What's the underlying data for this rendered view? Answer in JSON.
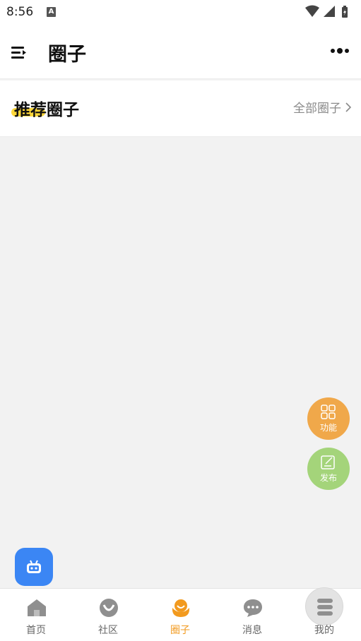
{
  "status_bar": {
    "time": "8:56",
    "notification_glyph": "A",
    "icons": [
      "wifi-icon",
      "signal-icon",
      "battery-icon"
    ]
  },
  "header": {
    "title": "圈子",
    "menu_icon": "menu-icon",
    "more_icon": "more-dots-icon"
  },
  "section": {
    "title": "推荐圈子",
    "all_link": "全部圈子",
    "highlight_color": "#ffd83a"
  },
  "floating": {
    "function_label": "功能",
    "post_label": "发布",
    "function_color": "#f0a84a",
    "post_color": "#a4d47a",
    "bot_color": "#3b86f4"
  },
  "tabs": [
    {
      "label": "首页",
      "icon": "home-icon",
      "active": false
    },
    {
      "label": "社区",
      "icon": "community-icon",
      "active": false
    },
    {
      "label": "圈子",
      "icon": "circle-icon",
      "active": true
    },
    {
      "label": "消息",
      "icon": "message-icon",
      "active": false
    },
    {
      "label": "我的",
      "icon": "profile-icon",
      "active": false
    }
  ],
  "colors": {
    "accent": "#f29a1f",
    "background": "#f2f2f2"
  }
}
